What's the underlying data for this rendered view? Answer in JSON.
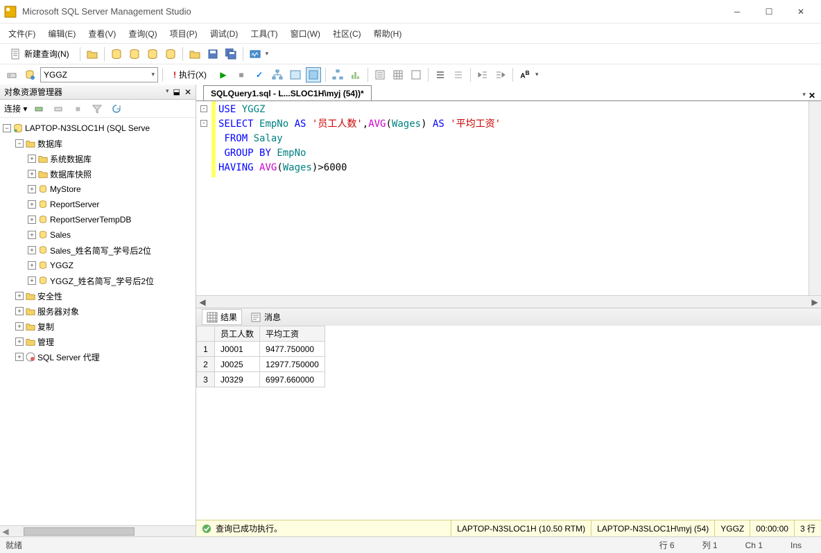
{
  "window": {
    "title": "Microsoft SQL Server Management Studio"
  },
  "menu": {
    "file": "文件(F)",
    "edit": "编辑(E)",
    "view": "查看(V)",
    "query": "查询(Q)",
    "project": "项目(P)",
    "debug": "调试(D)",
    "tools": "工具(T)",
    "window": "窗口(W)",
    "community": "社区(C)",
    "help": "帮助(H)"
  },
  "toolbar": {
    "new_query": "新建查询(N)",
    "execute": "执行(X)",
    "db_selected": "YGGZ"
  },
  "object_explorer": {
    "title": "对象资源管理器",
    "connect_label": "连接 ▾",
    "server": "LAPTOP-N3SLOC1H (SQL Serve",
    "databases_label": "数据库",
    "sys_db": "系统数据库",
    "db_snapshot": "数据库快照",
    "dbs": [
      "MyStore",
      "ReportServer",
      "ReportServerTempDB",
      "Sales",
      "Sales_姓名简写_学号后2位",
      "YGGZ",
      "YGGZ_姓名简写_学号后2位"
    ],
    "security": "安全性",
    "server_objects": "服务器对象",
    "replication": "复制",
    "management": "管理",
    "agent": "SQL Server 代理"
  },
  "document": {
    "tab_title": "SQLQuery1.sql - L...SLOC1H\\myj (54))*",
    "sql_lines": {
      "l1_use": "USE",
      "l1_db": "YGGZ",
      "l2_select": "SELECT",
      "l2_empno": "EmpNo",
      "l2_as1": "AS",
      "l2_s1": "'员工人数'",
      "l2_avg": "AVG",
      "l2_wages": "Wages",
      "l2_as2": "AS",
      "l2_s2": "'平均工资'",
      "l3_from": "FROM",
      "l3_salay": "Salay",
      "l4_group": "GROUP",
      "l4_by": "BY",
      "l4_empno": "EmpNo",
      "l5_having": "HAVING",
      "l5_avg": "AVG",
      "l5_wages": "Wages",
      "l5_num": ">6000"
    }
  },
  "results": {
    "tab_results": "结果",
    "tab_messages": "消息",
    "col1": "员工人数",
    "col2": "平均工资",
    "rows": [
      {
        "n": "1",
        "c1": "J0001",
        "c2": "9477.750000"
      },
      {
        "n": "2",
        "c1": "J0025",
        "c2": "12977.750000"
      },
      {
        "n": "3",
        "c1": "J0329",
        "c2": "6997.660000"
      }
    ]
  },
  "query_status": {
    "ok": "查询已成功执行。",
    "server": "LAPTOP-N3SLOC1H (10.50 RTM)",
    "user": "LAPTOP-N3SLOC1H\\myj (54)",
    "db": "YGGZ",
    "time": "00:00:00",
    "rows": "3 行"
  },
  "statusbar": {
    "ready": "就绪",
    "line": "行 6",
    "col": "列 1",
    "ch": "Ch 1",
    "ins": "Ins"
  }
}
